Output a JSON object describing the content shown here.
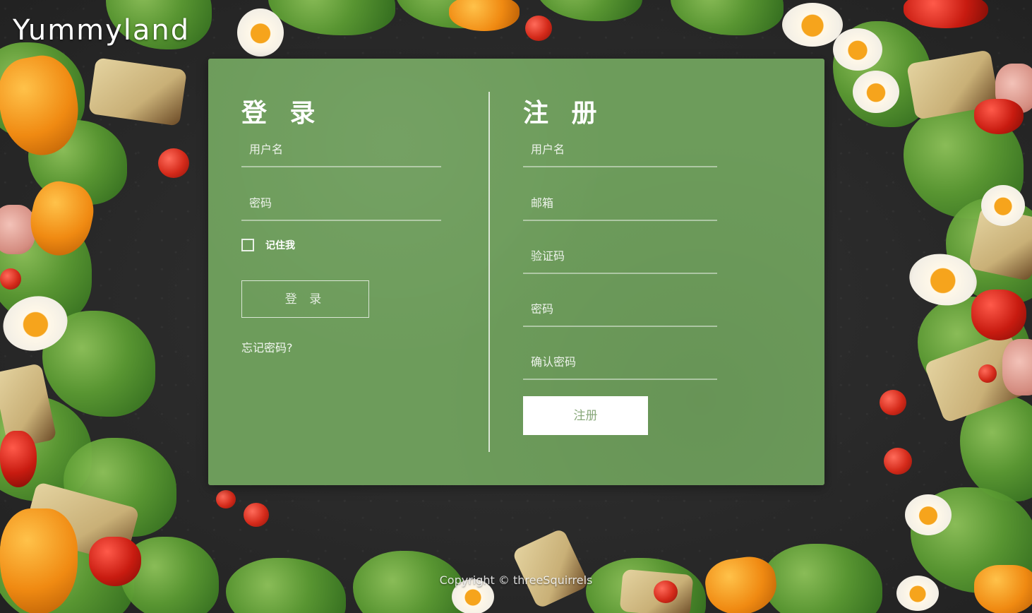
{
  "brand": {
    "name": "Yummyland"
  },
  "login": {
    "title": "登 录",
    "username_placeholder": "用户名",
    "password_placeholder": "密码",
    "remember_label": "记住我",
    "remember_checked": false,
    "submit_label": "登 录",
    "forgot_label": "忘记密码?"
  },
  "register": {
    "title": "注 册",
    "username_placeholder": "用户名",
    "email_placeholder": "邮箱",
    "code_placeholder": "验证码",
    "password_placeholder": "密码",
    "confirm_placeholder": "确认密码",
    "submit_label": "注册"
  },
  "footer": {
    "copyright": "Copyright © threeSquirrels"
  },
  "colors": {
    "panel": "#6d9c5b",
    "background": "#2b2b2b",
    "register_button_text": "#8aa97c"
  }
}
